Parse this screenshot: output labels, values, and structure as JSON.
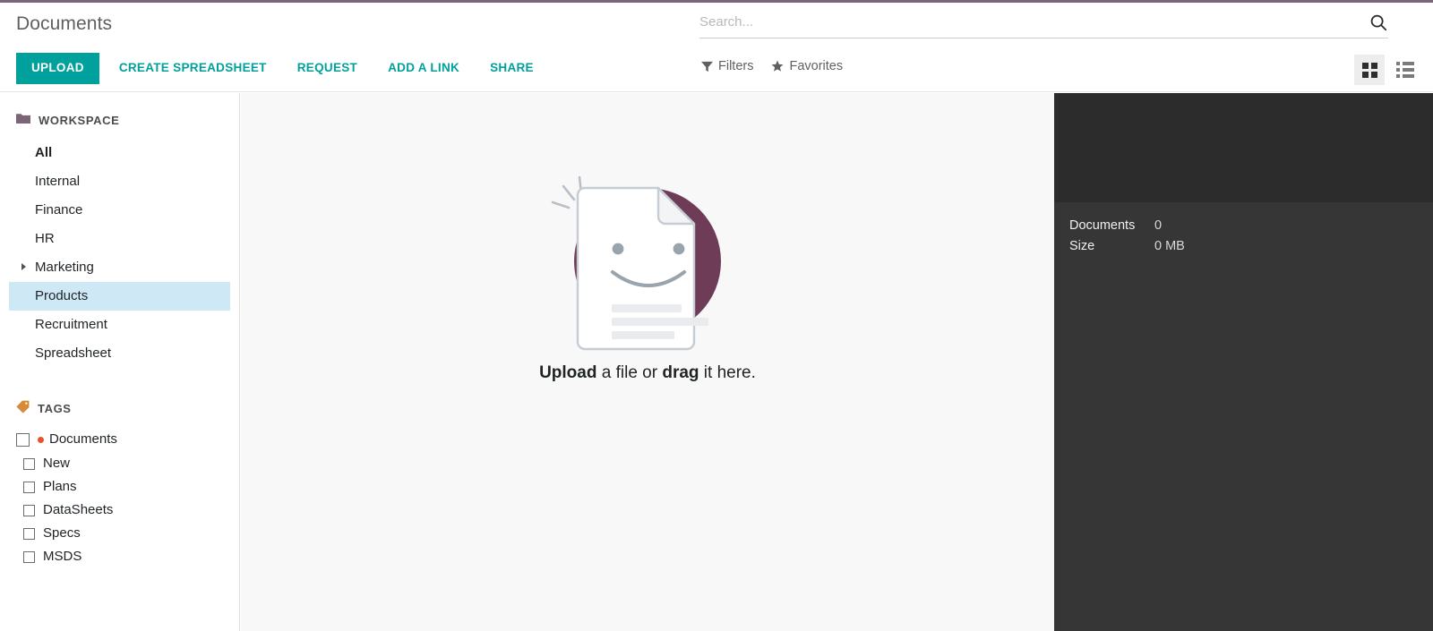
{
  "theme": {
    "accent_bar": "#7c6576",
    "primary": "#00a09d",
    "selection": "#cfe8f6",
    "tag_dot": "#e8522a",
    "inspector_bg": "#363636",
    "preview_bg": "#2c2c2c"
  },
  "header": {
    "breadcrumb": "Documents",
    "buttons": {
      "upload": "UPLOAD",
      "create_spreadsheet": "CREATE SPREADSHEET",
      "request": "REQUEST",
      "add_a_link": "ADD A LINK",
      "share": "SHARE"
    },
    "search": {
      "placeholder": "Search...",
      "value": "",
      "icon": "search-icon"
    },
    "filter_menus": [
      {
        "label": "Filters",
        "icon": "funnel-icon"
      },
      {
        "label": "Favorites",
        "icon": "star-icon"
      }
    ],
    "view_switcher": {
      "active": "kanban",
      "buttons": [
        {
          "name": "kanban",
          "icon": "grid-view-icon"
        },
        {
          "name": "list",
          "icon": "list-view-icon"
        }
      ]
    }
  },
  "sidebar": {
    "workspace": {
      "title": "WORKSPACE",
      "icon": "folder-icon",
      "items": [
        {
          "label": "All",
          "bold": true,
          "expandable": false,
          "selected": false
        },
        {
          "label": "Internal",
          "bold": false,
          "expandable": false,
          "selected": false
        },
        {
          "label": "Finance",
          "bold": false,
          "expandable": false,
          "selected": false
        },
        {
          "label": "HR",
          "bold": false,
          "expandable": false,
          "selected": false
        },
        {
          "label": "Marketing",
          "bold": false,
          "expandable": true,
          "selected": false
        },
        {
          "label": "Products",
          "bold": false,
          "expandable": false,
          "selected": true
        },
        {
          "label": "Recruitment",
          "bold": false,
          "expandable": false,
          "selected": false
        },
        {
          "label": "Spreadsheet",
          "bold": false,
          "expandable": false,
          "selected": false
        }
      ]
    },
    "tags": {
      "title": "TAGS",
      "icon": "tag-icon",
      "facets": [
        {
          "label": "Documents",
          "checked": false,
          "has_dot": true,
          "children": [
            {
              "label": "New",
              "checked": false
            },
            {
              "label": "Plans",
              "checked": false
            },
            {
              "label": "DataSheets",
              "checked": false
            },
            {
              "label": "Specs",
              "checked": false
            },
            {
              "label": "MSDS",
              "checked": false
            }
          ]
        }
      ]
    }
  },
  "main": {
    "empty_state": {
      "illustration": "smiling-document-icon",
      "caption_bold_1": "Upload",
      "caption_mid": " a file or ",
      "caption_bold_2": "drag",
      "caption_end": " it here."
    }
  },
  "inspector": {
    "stats": [
      {
        "label": "Documents",
        "value": "0"
      },
      {
        "label": "Size",
        "value": "0 MB"
      }
    ]
  }
}
